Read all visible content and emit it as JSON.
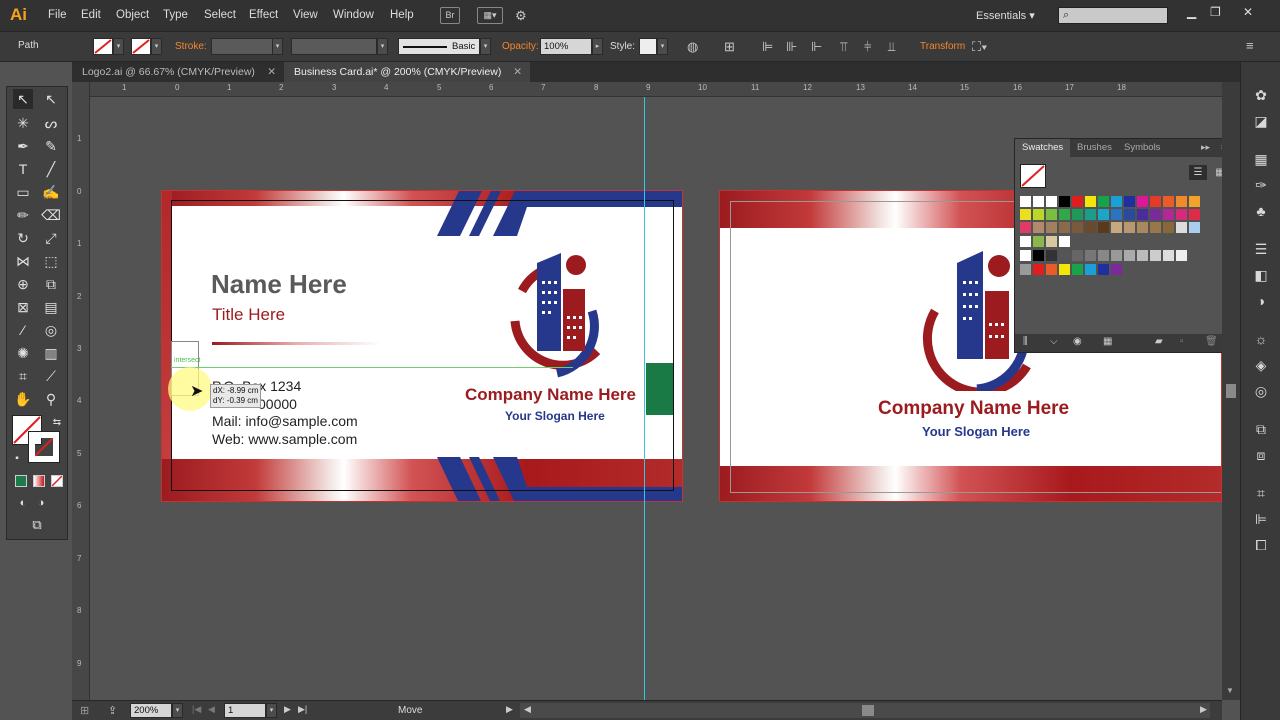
{
  "app": {
    "logo": "Ai"
  },
  "menu": [
    "File",
    "Edit",
    "Object",
    "Type",
    "Select",
    "Effect",
    "View",
    "Window",
    "Help"
  ],
  "menu_extra": {
    "br": "Br"
  },
  "workspace": "Essentials",
  "control_bar": {
    "selection_type": "Path",
    "stroke_label": "Stroke:",
    "brush_style": "Basic",
    "opacity_label": "Opacity:",
    "opacity_value": "100%",
    "style_label": "Style:",
    "transform_label": "Transform"
  },
  "tabs": [
    {
      "label": "Logo2.ai @ 66.67% (CMYK/Preview)",
      "active": false
    },
    {
      "label": "Business Card.ai* @ 200% (CMYK/Preview)",
      "active": true
    }
  ],
  "ruler": {
    "top": [
      "1",
      "0",
      "1",
      "2",
      "3",
      "4",
      "5",
      "6",
      "7",
      "8",
      "9",
      "10",
      "11",
      "12",
      "13",
      "14",
      "15",
      "16",
      "17",
      "18"
    ],
    "left": [
      "1",
      "0",
      "1",
      "2",
      "3",
      "4",
      "5",
      "6",
      "7",
      "8",
      "9"
    ]
  },
  "card_front": {
    "name": "Name Here",
    "title": "Title Here",
    "contact": [
      "P.O. Box 1234",
      "00000",
      "Mail: info@sample.com",
      "Web: www.sample.com"
    ],
    "company": "Company Name Here",
    "slogan": "Your Slogan Here",
    "smart_guide": "intersect",
    "move_dx": "dX: -8.99 cm",
    "move_dy": "dY: -0.39 cm"
  },
  "card_back": {
    "company": "Company Name Here",
    "slogan": "Your Slogan Here"
  },
  "swatches_panel": {
    "tabs": [
      "Swatches",
      "Brushes",
      "Symbols"
    ],
    "active_tab": "Swatches"
  },
  "status": {
    "zoom": "200%",
    "artboard": "1",
    "tool": "Move"
  },
  "colors": {
    "brand_red": "#9b1b1f",
    "brand_blue": "#26388c",
    "ui_orange": "#f5872b",
    "panel": "#535353"
  }
}
